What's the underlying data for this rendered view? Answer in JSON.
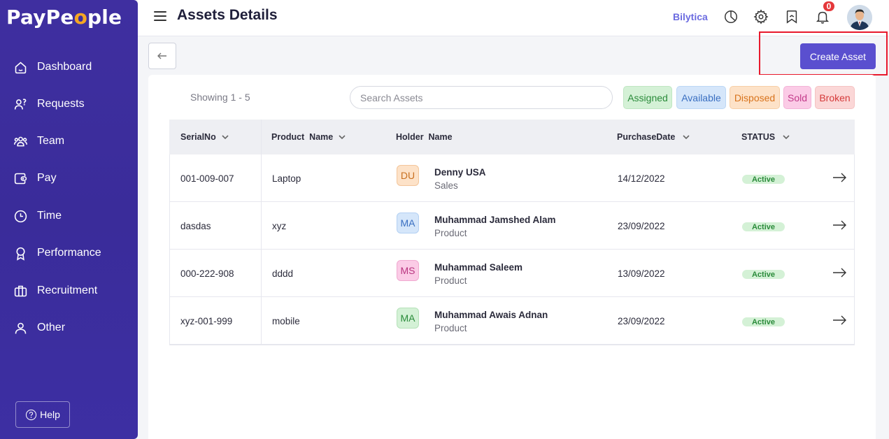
{
  "sidebar": {
    "logo_prefix": "PayPe",
    "logo_dot": "o",
    "logo_suffix": "ple",
    "items": [
      {
        "label": "Dashboard",
        "icon": "home-icon"
      },
      {
        "label": "Requests",
        "icon": "requests-icon"
      },
      {
        "label": "Team",
        "icon": "team-icon"
      },
      {
        "label": "Pay",
        "icon": "wallet-icon"
      },
      {
        "label": "Time",
        "icon": "clock-icon"
      },
      {
        "label": "Performance",
        "icon": "award-icon"
      },
      {
        "label": "Recruitment",
        "icon": "briefcase-icon"
      },
      {
        "label": "Other",
        "icon": "user-icon"
      }
    ],
    "help_label": "Help"
  },
  "header": {
    "title": "Assets Details",
    "company": "Bilytica",
    "notification_count": "0"
  },
  "toolbar": {
    "create_label": "Create Asset"
  },
  "filters": {
    "showing": "Showing 1 - 5",
    "search_placeholder": "Search Assets",
    "chips": [
      {
        "label": "Assigned",
        "bg": "#d4f1d6",
        "fg": "#2a8b3a",
        "border": "#bfe6c2"
      },
      {
        "label": "Available",
        "bg": "#d5e6fa",
        "fg": "#3a6fc1",
        "border": "#bcd7f5"
      },
      {
        "label": "Disposed",
        "bg": "#fde2c8",
        "fg": "#d8731c",
        "border": "#f7cfa7"
      },
      {
        "label": "Sold",
        "bg": "#fbcbe6",
        "fg": "#c23a8a",
        "border": "#f3b3d7"
      },
      {
        "label": "Broken",
        "bg": "#fbd7d7",
        "fg": "#d53a3a",
        "border": "#f5c2c2"
      }
    ]
  },
  "table": {
    "headers": {
      "serial": "SerialNo",
      "product": "Product  Name",
      "holder": "Holder  Name",
      "date": "PurchaseDate",
      "status": "STATUS"
    },
    "rows": [
      {
        "serial": "001-009-007",
        "product": "Laptop",
        "initials": "DU",
        "initials_bg": "#fde2c8",
        "initials_fg": "#c87020",
        "initials_border": "#f3c59a",
        "holder": "Denny USA",
        "dept": "Sales",
        "date": "14/12/2022",
        "status": "Active"
      },
      {
        "serial": "dasdas",
        "product": "xyz",
        "initials": "MA",
        "initials_bg": "#d5e6fa",
        "initials_fg": "#3a6fc1",
        "initials_border": "#b3d0f3",
        "holder": "Muhammad Jamshed Alam",
        "dept": "Product",
        "date": "23/09/2022",
        "status": "Active"
      },
      {
        "serial": "000-222-908",
        "product": "dddd",
        "initials": "MS",
        "initials_bg": "#fbcbe6",
        "initials_fg": "#b8357f",
        "initials_border": "#f0a9d0",
        "holder": "Muhammad Saleem",
        "dept": "Product",
        "date": "13/09/2022",
        "status": "Active"
      },
      {
        "serial": "xyz-001-999",
        "product": "mobile",
        "initials": "MA",
        "initials_bg": "#d4f1d6",
        "initials_fg": "#2a8b3a",
        "initials_border": "#b5e2b9",
        "holder": "Muhammad Awais Adnan",
        "dept": "Product",
        "date": "23/09/2022",
        "status": "Active"
      }
    ]
  }
}
